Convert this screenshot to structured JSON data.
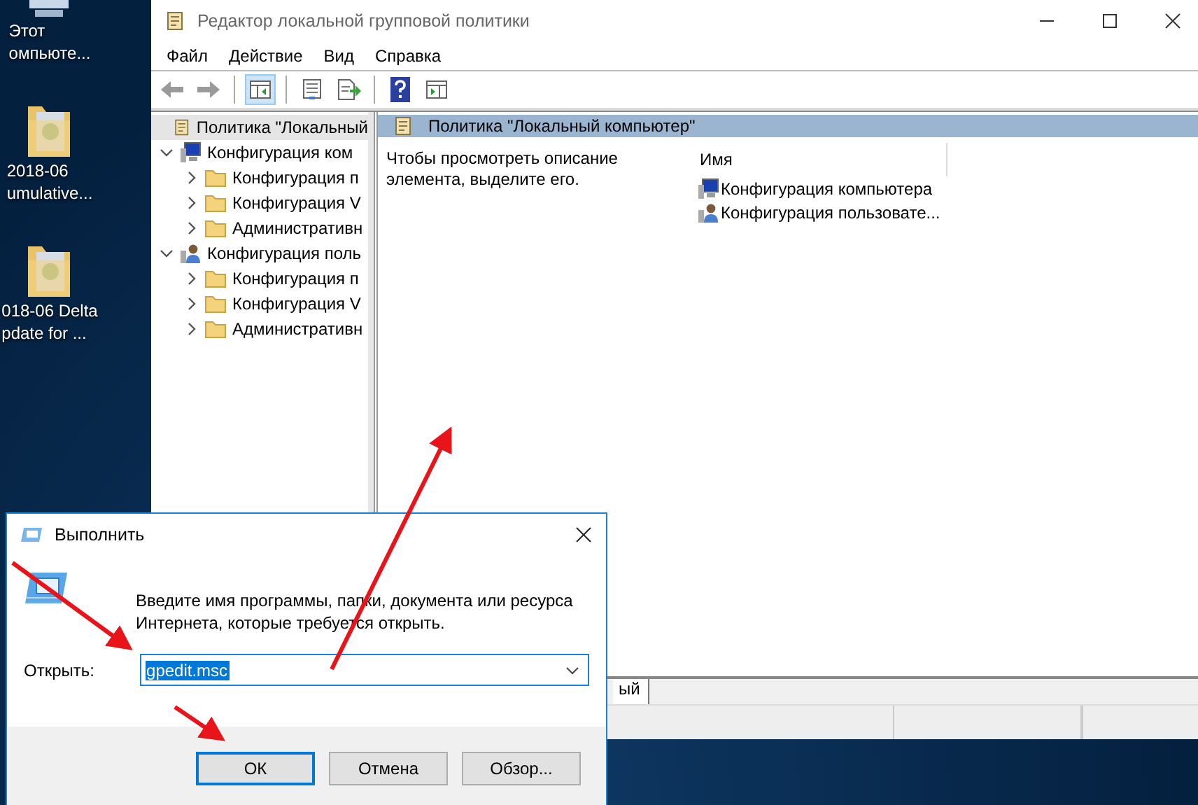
{
  "desktop": {
    "icons": [
      {
        "kind": "computer",
        "lines": [
          "Этот",
          "омпьюте..."
        ]
      },
      {
        "kind": "folder",
        "lines": [
          "2018-06",
          "umulative..."
        ]
      },
      {
        "kind": "folder",
        "lines": [
          "018-06 Delta",
          "pdate for ..."
        ]
      }
    ]
  },
  "window": {
    "title": "Редактор локальной групповой политики",
    "menu": [
      "Файл",
      "Действие",
      "Вид",
      "Справка"
    ],
    "toolbar": [
      [
        {
          "kind": "back",
          "selected": false
        },
        {
          "kind": "forward",
          "selected": false
        }
      ],
      [
        {
          "kind": "tree",
          "selected": true
        }
      ],
      [
        {
          "kind": "properties",
          "selected": false
        },
        {
          "kind": "export",
          "selected": false
        }
      ],
      [
        {
          "kind": "help",
          "selected": false
        },
        {
          "kind": "pane",
          "selected": false
        }
      ]
    ],
    "tree": [
      {
        "label": "Политика \"Локальный",
        "kind": "policy",
        "selected": true,
        "children": [
          {
            "label": "Конфигурация ком",
            "kind": "computer",
            "expanded": true,
            "selected": false,
            "children": [
              {
                "label": "Конфигурация п",
                "kind": "folder",
                "expanded": false,
                "selected": false
              },
              {
                "label": "Конфигурация V",
                "kind": "folder",
                "expanded": false,
                "selected": false
              },
              {
                "label": "Административн",
                "kind": "folder",
                "expanded": false,
                "selected": false
              }
            ]
          },
          {
            "label": "Конфигурация поль",
            "kind": "user",
            "expanded": true,
            "selected": false,
            "children": [
              {
                "label": "Конфигурация п",
                "kind": "folder",
                "expanded": false,
                "selected": false
              },
              {
                "label": "Конфигурация V",
                "kind": "folder",
                "expanded": false,
                "selected": false
              },
              {
                "label": "Административн",
                "kind": "folder",
                "expanded": false,
                "selected": false
              }
            ]
          }
        ]
      }
    ],
    "details": {
      "header": "Политика \"Локальный компьютер\"",
      "description": "Чтобы просмотреть описание элемента, выделите его.",
      "column": "Имя",
      "items": [
        {
          "label": "Конфигурация компьютера",
          "kind": "computer"
        },
        {
          "label": "Конфигурация пользовате...",
          "kind": "user"
        }
      ]
    },
    "tabs": [
      {
        "label": "ый",
        "selected": true
      }
    ]
  },
  "run_dialog": {
    "title": "Выполнить",
    "prompt": "Введите имя программы, папки, документа или ресурса Интернета, которые требуется открыть.",
    "field_label": "Открыть:",
    "value": "gpedit.msc",
    "buttons": [
      {
        "label": "ОК",
        "default": true
      },
      {
        "label": "Отмена",
        "default": false
      },
      {
        "label": "Обзор...",
        "default": false
      }
    ]
  }
}
